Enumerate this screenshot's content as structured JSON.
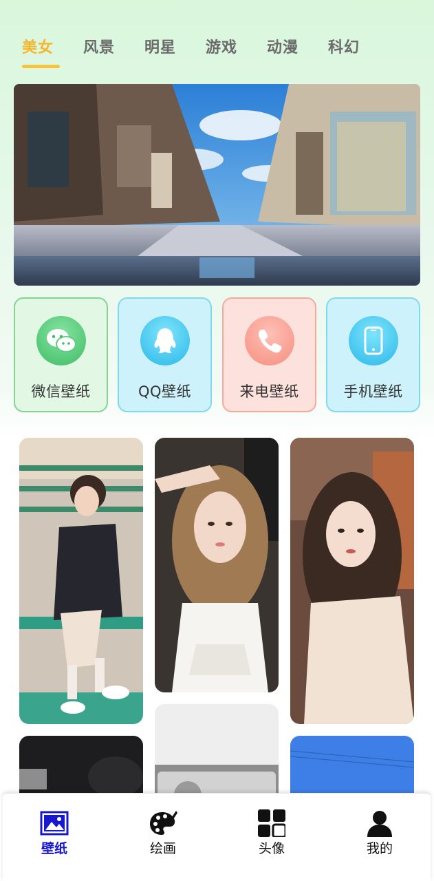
{
  "tabs": [
    {
      "label": "美女",
      "active": true
    },
    {
      "label": "风景",
      "active": false
    },
    {
      "label": "明星",
      "active": false
    },
    {
      "label": "游戏",
      "active": false
    },
    {
      "label": "动漫",
      "active": false
    },
    {
      "label": "科幻",
      "active": false
    }
  ],
  "banner": {
    "icon": "street-reflection-photo"
  },
  "features": [
    {
      "label": "微信壁纸",
      "icon": "wechat-icon"
    },
    {
      "label": "QQ壁纸",
      "icon": "qq-penguin-icon"
    },
    {
      "label": "来电壁纸",
      "icon": "phone-call-icon"
    },
    {
      "label": "手机壁纸",
      "icon": "smartphone-icon"
    }
  ],
  "bottom_nav": [
    {
      "label": "壁纸",
      "icon": "wallpaper-image-icon",
      "active": true
    },
    {
      "label": "绘画",
      "icon": "palette-brush-icon",
      "active": false
    },
    {
      "label": "头像",
      "icon": "grid-apps-icon",
      "active": false
    },
    {
      "label": "我的",
      "icon": "user-profile-icon",
      "active": false
    }
  ],
  "colors": {
    "tab_active": "#f5b72c",
    "tab_indicator": "#f5c33f",
    "nav_active": "#1717d0",
    "wechat_green": "#3fbd66",
    "qq_blue": "#2bb8ea",
    "call_coral": "#f58e80"
  }
}
